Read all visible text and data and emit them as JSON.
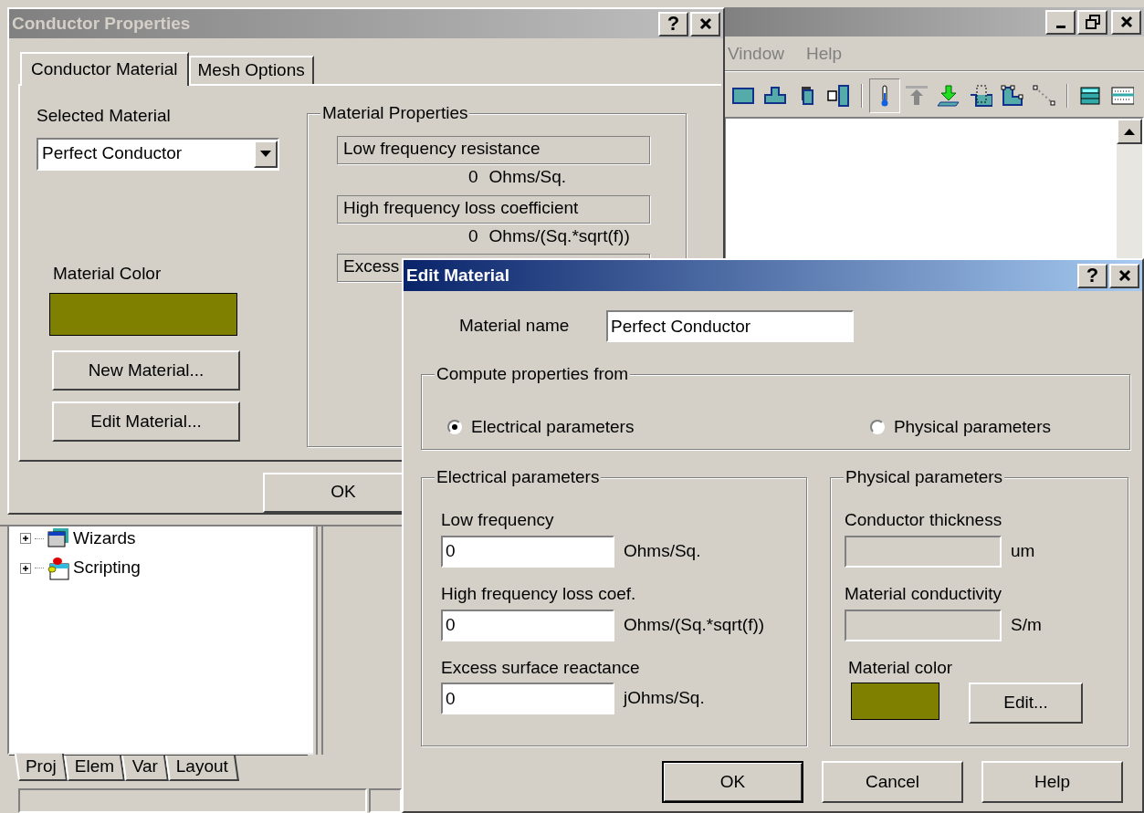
{
  "app_window": {
    "menu": [
      "Vindow",
      "Help"
    ],
    "toolbar": [
      {
        "pressed": false
      },
      {
        "pressed": false
      },
      {
        "pressed": false
      },
      {
        "pressed": false
      },
      {
        "pressed": true
      },
      {
        "pressed": false
      },
      {
        "pressed": false
      },
      {
        "pressed": false
      },
      {
        "pressed": false
      },
      {
        "pressed": false
      },
      {
        "pressed": false
      },
      {
        "pressed": false
      }
    ],
    "tree": [
      {
        "label": "Wizards",
        "expanded": false
      },
      {
        "label": "Scripting",
        "expanded": false
      }
    ],
    "panel_tabs": [
      {
        "label": "Proj",
        "selected": true
      },
      {
        "label": "Elem",
        "selected": false
      },
      {
        "label": "Var",
        "selected": false
      },
      {
        "label": "Layout",
        "selected": false
      }
    ]
  },
  "conductor_dialog": {
    "title": "Conductor Properties",
    "help_button": "?",
    "tabs": [
      {
        "label": "Conductor Material",
        "selected": true
      },
      {
        "label": "Mesh Options",
        "selected": false
      }
    ],
    "selected_material_label": "Selected Material",
    "material_select": "Perfect Conductor",
    "material_color_label": "Material Color",
    "buttons": [
      "New Material...",
      "Edit Material..."
    ],
    "properties": {
      "title": "Material Properties",
      "rows": [
        {
          "label": "Low frequency resistance",
          "value": "0",
          "unit": "Ohms/Sq."
        },
        {
          "label": "High frequency loss coefficient",
          "value": "0",
          "unit": "Ohms/(Sq.*sqrt(f))"
        },
        {
          "label": "Excess"
        }
      ]
    },
    "ok_button": "OK"
  },
  "edit_dialog": {
    "title": "Edit Material",
    "help_button": "?",
    "name_label": "Material name",
    "name_value": "Perfect Conductor",
    "compute": {
      "title": "Compute properties from",
      "options": [
        {
          "label": "Electrical parameters",
          "selected": true
        },
        {
          "label": "Physical parameters",
          "selected": false
        }
      ]
    },
    "electrical": {
      "title": "Electrical parameters",
      "fields": [
        {
          "label": "Low frequency",
          "value": "0",
          "unit": "Ohms/Sq.",
          "disabled": false
        },
        {
          "label": "High frequency loss coef.",
          "value": "0",
          "unit": "Ohms/(Sq.*sqrt(f))",
          "disabled": false
        },
        {
          "label": "Excess surface reactance",
          "value": "0",
          "unit": "jOhms/Sq.",
          "disabled": false
        }
      ]
    },
    "physical": {
      "title": "Physical parameters",
      "fields": [
        {
          "label": "Conductor thickness",
          "unit": "um",
          "disabled": true
        },
        {
          "label": "Material conductivity",
          "unit": "S/m",
          "disabled": true
        }
      ],
      "color_label": "Material color",
      "edit_button": "Edit..."
    },
    "buttons": [
      "OK",
      "Cancel",
      "Help"
    ]
  }
}
